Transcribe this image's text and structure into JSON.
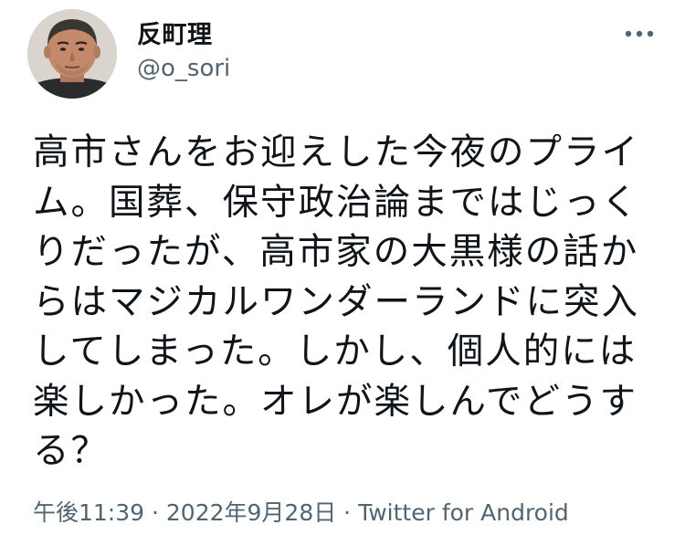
{
  "user": {
    "display_name": "反町理",
    "handle": "@o_sori"
  },
  "menu": {
    "icon": "more-horizontal-icon"
  },
  "tweet": {
    "text": "高市さんをお迎えした今夜のプライム。国葬、保守政治論まではじっくりだったが、高市家の大黒様の話からはマジカルワンダーランドに突入してしまった。しかし、個人的には楽しかった。オレが楽しんでどうする？"
  },
  "meta": {
    "time": "午後11:39",
    "sep1": " · ",
    "date": "2022年9月28日",
    "sep2": " · ",
    "source": "Twitter for Android"
  },
  "colors": {
    "text": "#0f1419",
    "secondary": "#536471",
    "background": "#ffffff"
  }
}
